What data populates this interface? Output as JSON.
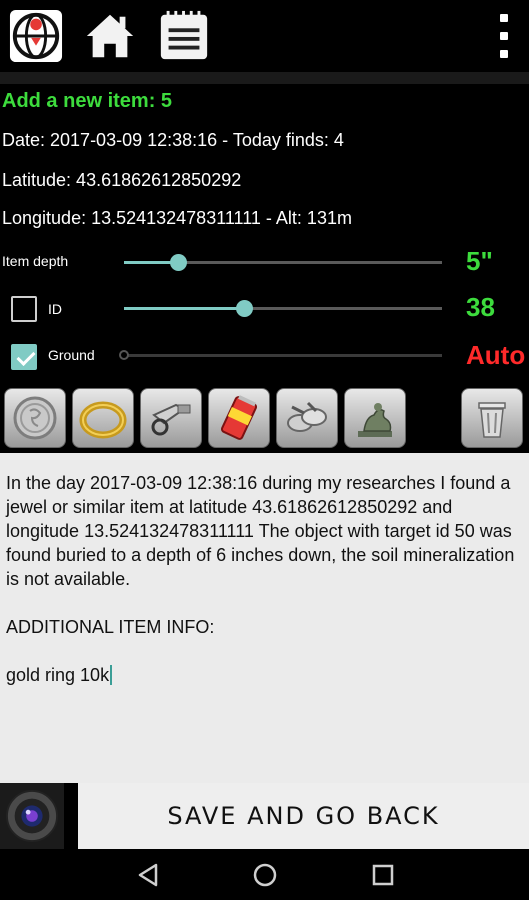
{
  "app": {
    "toolbar": {
      "icons": [
        "globe-pin-icon",
        "home-icon",
        "notes-icon",
        "overflow-menu-icon"
      ]
    }
  },
  "info": {
    "title": "Add a new item: 5",
    "date_line": "Date: 2017-03-09 12:38:16 - Today finds: 4",
    "latitude_line": "Latitude: 43.61862612850292",
    "longitude_line": "Longitude: 13.524132478311111 - Alt: 131m"
  },
  "controls": {
    "depth": {
      "label": "Item depth",
      "value_text": "5\"",
      "level": 0.17
    },
    "id": {
      "label": "ID",
      "checked": false,
      "value_text": "38",
      "level": 0.38
    },
    "ground": {
      "label": "Ground",
      "checked": true,
      "value_text": "Auto",
      "level": 0.0
    }
  },
  "categories": [
    "coin-icon",
    "ring-icon",
    "relic-icon",
    "can-icon",
    "scrap-metal-icon",
    "statue-icon",
    "trash-icon"
  ],
  "notes": {
    "paragraph": "In the day 2017-03-09 12:38:16 during my researches I found a jewel or similar item at latitude 43.61862612850292 and longitude 13.524132478311111 The object with target id 50 was found buried to a depth of 6 inches down, the soil mineralization is not available.",
    "additional_header": "ADDITIONAL ITEM INFO:",
    "user_input": "gold ring 10k"
  },
  "actions": {
    "save_label": "SAVE AND GO BACK",
    "camera_icon": "camera-icon"
  },
  "nav": [
    "back-icon",
    "home-circle-icon",
    "recents-icon"
  ],
  "colors": {
    "accent": "#80cbc4",
    "green": "#3ddc3d",
    "red": "#ff2a2a"
  }
}
